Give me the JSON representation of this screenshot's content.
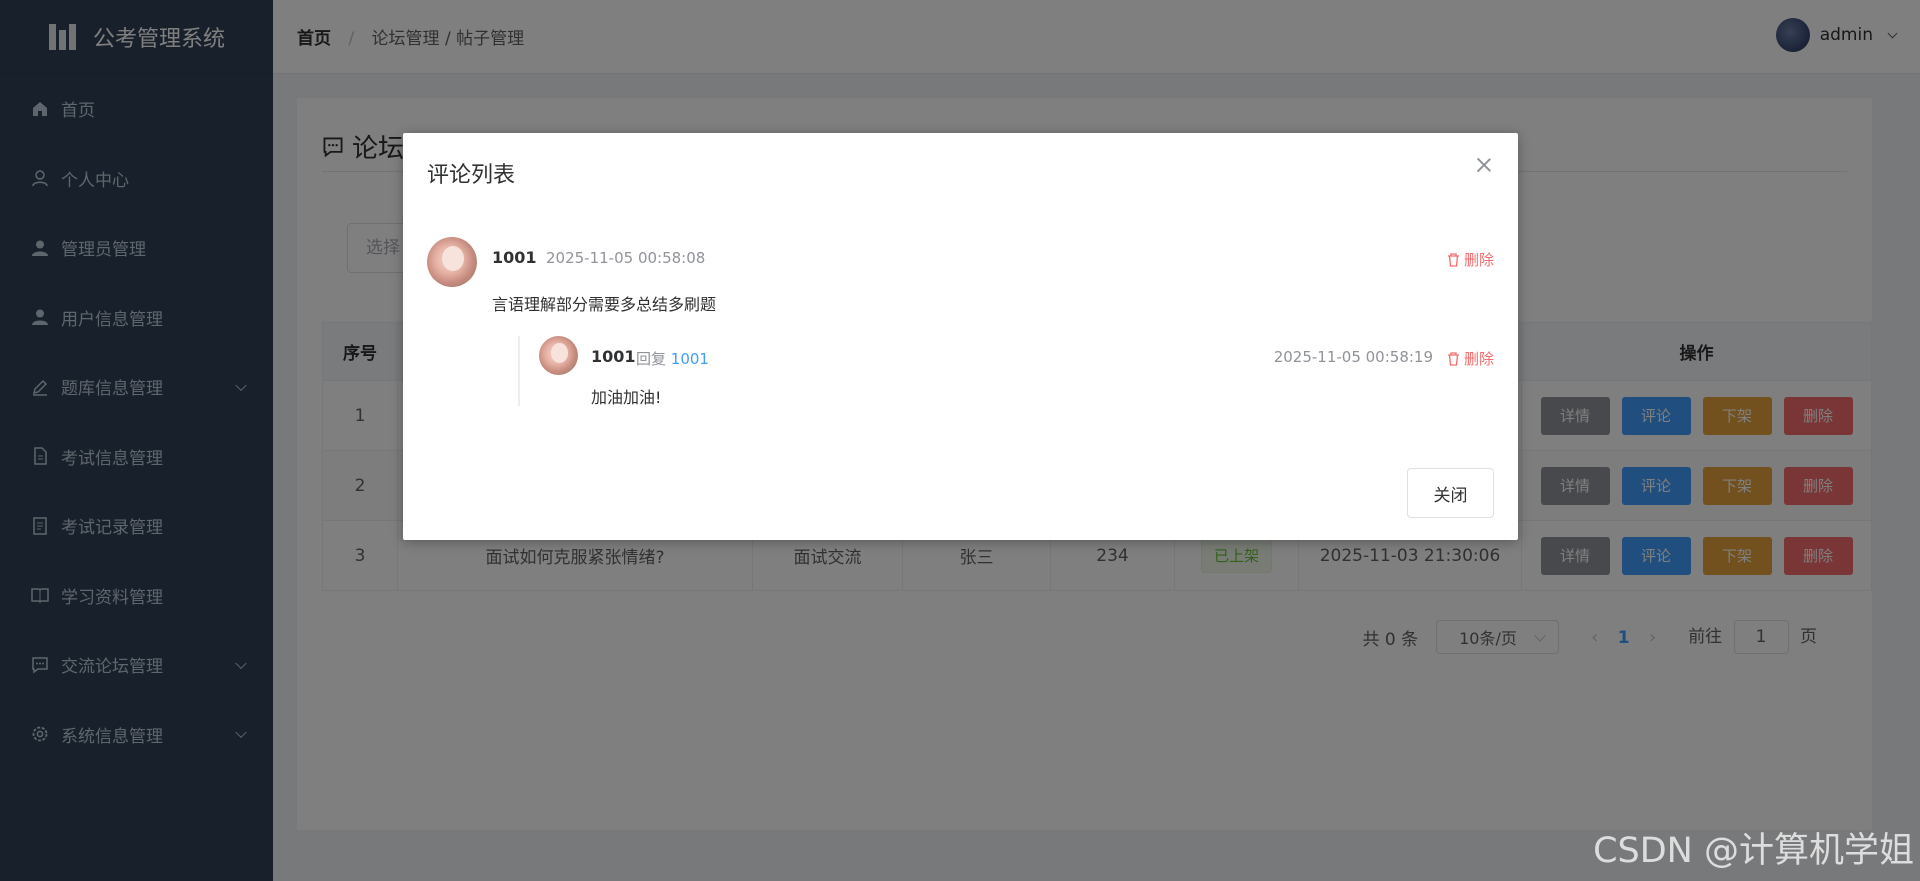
{
  "app": {
    "title": "公考管理系统"
  },
  "sidebar": {
    "items": [
      {
        "label": "首页",
        "icon": "home-icon",
        "has_children": false
      },
      {
        "label": "个人中心",
        "icon": "user-outline-icon",
        "has_children": false
      },
      {
        "label": "管理员管理",
        "icon": "user-icon",
        "has_children": false
      },
      {
        "label": "用户信息管理",
        "icon": "user-icon",
        "has_children": false
      },
      {
        "label": "题库信息管理",
        "icon": "edit-icon",
        "has_children": true
      },
      {
        "label": "考试信息管理",
        "icon": "document-icon",
        "has_children": false
      },
      {
        "label": "考试记录管理",
        "icon": "list-icon",
        "has_children": false
      },
      {
        "label": "学习资料管理",
        "icon": "book-icon",
        "has_children": false
      },
      {
        "label": "交流论坛管理",
        "icon": "chat-icon",
        "has_children": true
      },
      {
        "label": "系统信息管理",
        "icon": "gear-icon",
        "has_children": true
      }
    ]
  },
  "header": {
    "breadcrumb_home": "首页",
    "breadcrumb_sep": "/",
    "breadcrumb_rest": "论坛管理 / 帖子管理",
    "username": "admin"
  },
  "main": {
    "title": "论坛帖子管理",
    "filter_placeholder": "选择",
    "table": {
      "headers": [
        "序号",
        "",
        "",
        "",
        "",
        "",
        "",
        "操作"
      ],
      "rows": [
        {
          "index": "1",
          "title": "",
          "category": "",
          "author": "",
          "views": "",
          "status": "",
          "time": ""
        },
        {
          "index": "2",
          "title": "",
          "category": "",
          "author": "",
          "views": "",
          "status": "",
          "time": ""
        },
        {
          "index": "3",
          "title": "面试如何克服紧张情绪?",
          "category": "面试交流",
          "author": "张三",
          "views": "234",
          "status": "已上架",
          "time": "2025-11-03 21:30:06"
        }
      ],
      "actions": {
        "detail": "详情",
        "comment": "评论",
        "offline": "下架",
        "delete": "删除"
      }
    },
    "pager": {
      "total_text": "共 0 条",
      "page_size": "10条/页",
      "current_page": "1",
      "goto_label": "前往",
      "goto_value": "1",
      "page_suffix": "页"
    }
  },
  "dialog": {
    "title": "评论列表",
    "comments": [
      {
        "user": "1001",
        "time": "2025-11-05 00:58:08",
        "text": "言语理解部分需要多总结多刷题",
        "delete_label": "删除"
      }
    ],
    "reply": {
      "user": "1001",
      "reply_word": "回复",
      "reply_to": "1001",
      "time": "2025-11-05 00:58:19",
      "text": "加油加油!",
      "delete_label": "删除"
    },
    "close_button": "关闭"
  },
  "watermark": "CSDN @计算机学姐",
  "colors": {
    "sidebar_bg": "#304156",
    "primary": "#409eff",
    "danger": "#f56c6c",
    "warning": "#e6a23c",
    "info": "#909399",
    "success": "#67c23a"
  }
}
